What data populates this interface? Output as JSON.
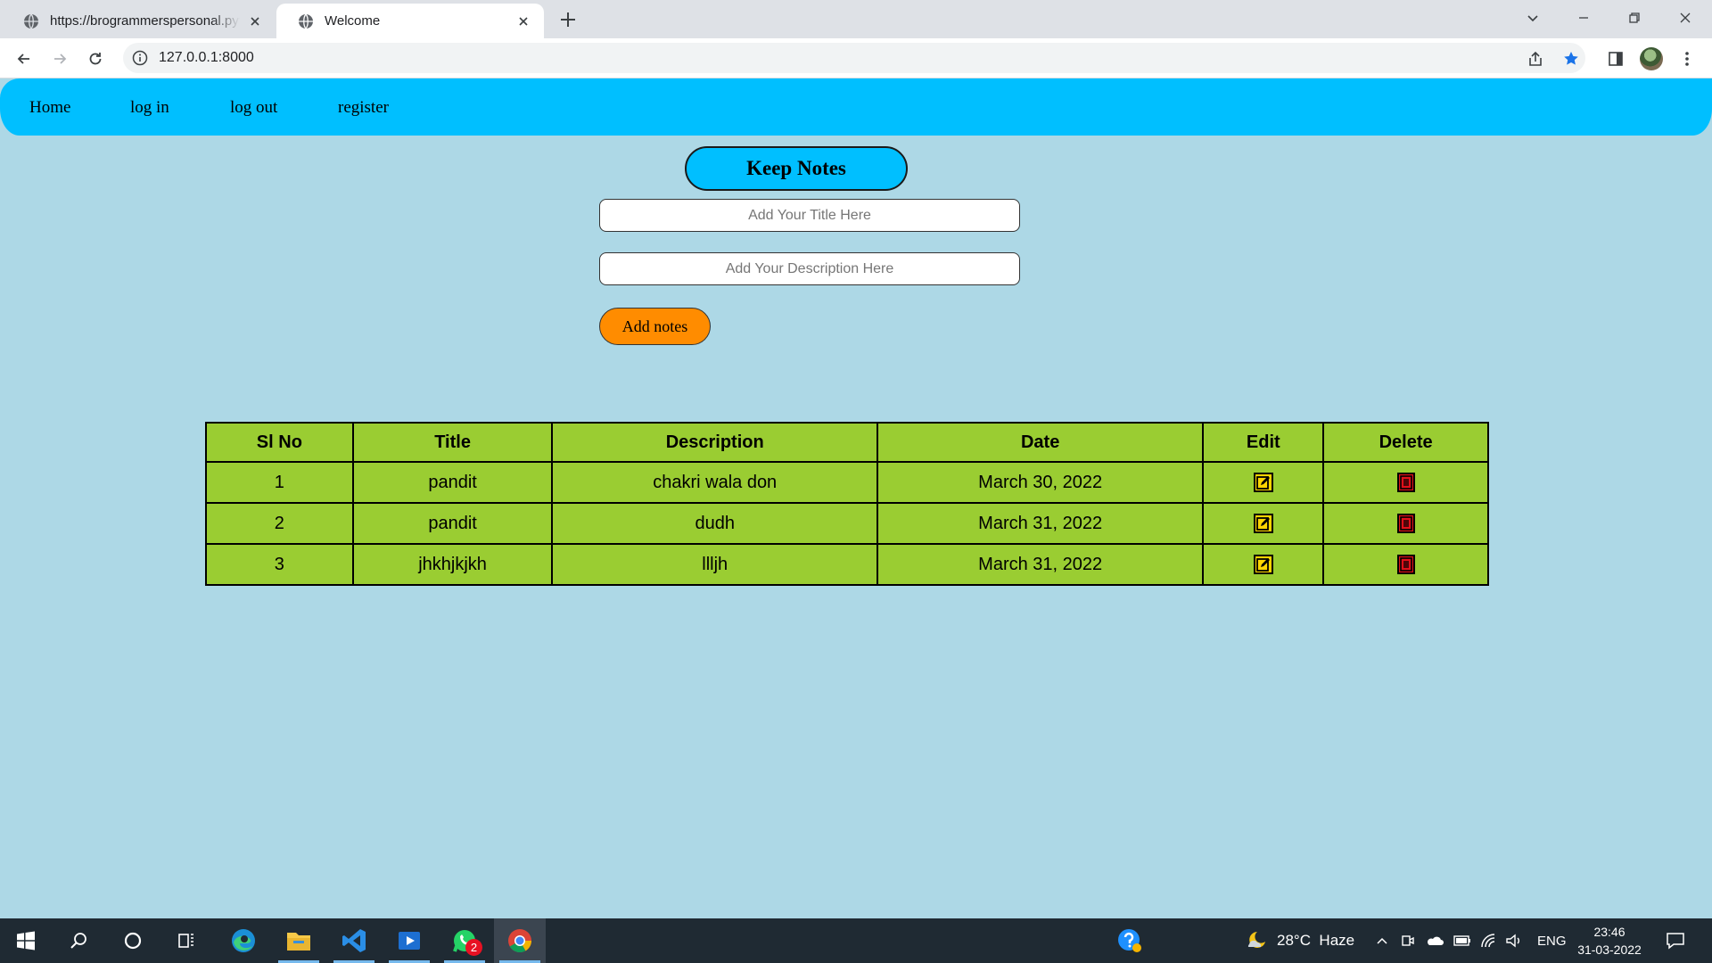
{
  "browser": {
    "tabs": [
      {
        "title": "https://brogrammerspersonal.pyt"
      },
      {
        "title": "Welcome"
      }
    ],
    "url": "127.0.0.1:8000"
  },
  "nav": {
    "links": [
      "Home",
      "log in",
      "log out",
      "register"
    ]
  },
  "form": {
    "heading": "Keep Notes",
    "title_placeholder": "Add Your Title Here",
    "description_placeholder": "Add Your Description Here",
    "add_button": "Add notes"
  },
  "table": {
    "headers": [
      "Sl No",
      "Title",
      "Description",
      "Date",
      "Edit",
      "Delete"
    ],
    "rows": [
      {
        "sl": "1",
        "title": "pandit",
        "description": "chakri wala don",
        "date": "March 30, 2022"
      },
      {
        "sl": "2",
        "title": "pandit",
        "description": "dudh",
        "date": "March 31, 2022"
      },
      {
        "sl": "3",
        "title": "jhkhjkjkh",
        "description": "llljh",
        "date": "March 31, 2022"
      }
    ],
    "edit_icon": "edit-icon",
    "delete_icon": "trash-icon"
  },
  "taskbar": {
    "whatsapp_badge": "2",
    "weather": "28°C  Haze",
    "language": "ENG",
    "time": "23:46",
    "date": "31-03-2022"
  },
  "colors": {
    "page_bg": "#add8e6",
    "nav_bg": "#00bfff",
    "table_bg": "#9acd32",
    "button_bg": "#ff8c00"
  }
}
